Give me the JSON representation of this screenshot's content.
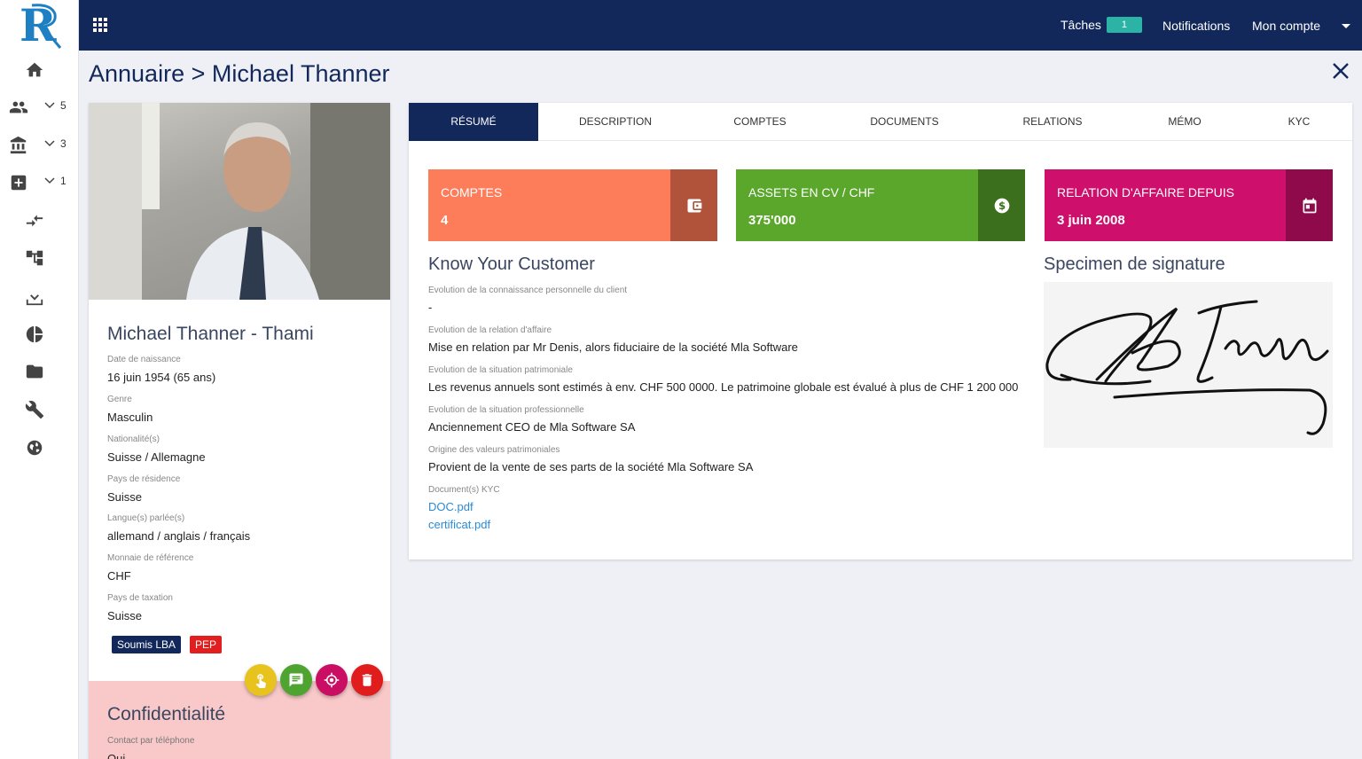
{
  "topbar": {
    "tasks_label": "Tâches",
    "tasks_count": "1",
    "notifications_label": "Notifications",
    "account_label": "Mon compte"
  },
  "sidebar": {
    "items": [
      {
        "icon": "home-icon",
        "count": ""
      },
      {
        "icon": "users-icon",
        "count": "5"
      },
      {
        "icon": "bank-icon",
        "count": "3"
      },
      {
        "icon": "add-box-icon",
        "count": "1"
      },
      {
        "icon": "transfer-icon",
        "count": ""
      },
      {
        "icon": "hierarchy-icon",
        "count": ""
      },
      {
        "icon": "download-icon",
        "count": ""
      },
      {
        "icon": "pie-chart-icon",
        "count": ""
      },
      {
        "icon": "folder-icon",
        "count": ""
      },
      {
        "icon": "wrench-icon",
        "count": ""
      },
      {
        "icon": "globe-icon",
        "count": ""
      }
    ]
  },
  "breadcrumb": {
    "root": "Annuaire",
    "separator": ">",
    "current": "Michael Thanner"
  },
  "profile": {
    "name": "Michael Thanner - Thami",
    "fields": [
      {
        "label": "Date de naissance",
        "value": "16 juin 1954 (65 ans)"
      },
      {
        "label": "Genre",
        "value": "Masculin"
      },
      {
        "label": "Nationalité(s)",
        "value": "Suisse / Allemagne"
      },
      {
        "label": "Pays de résidence",
        "value": "Suisse"
      },
      {
        "label": "Langue(s) parlée(s)",
        "value": "allemand / anglais / français"
      },
      {
        "label": "Monnaie de référence",
        "value": "CHF"
      },
      {
        "label": "Pays de taxation",
        "value": "Suisse"
      }
    ],
    "tags": {
      "lba": "Soumis LBA",
      "pep": "PEP"
    },
    "confidentiality": {
      "title": "Confidentialité",
      "label": "Contact par téléphone",
      "value": "Oui"
    }
  },
  "tabs": [
    "RÉSUMÉ",
    "DESCRIPTION",
    "COMPTES",
    "DOCUMENTS",
    "RELATIONS",
    "MÉMO",
    "KYC"
  ],
  "stats": [
    {
      "label": "COMPTES",
      "value": "4",
      "color": "#fd7d5a",
      "icon_bg": "#b1533b",
      "icon": "wallet-icon"
    },
    {
      "label": "ASSETS EN CV / CHF",
      "value": "375'000",
      "color": "#5aa72b",
      "icon_bg": "#3b6e1d",
      "icon": "dollar-icon"
    },
    {
      "label": "RELATION D'AFFAIRE DEPUIS",
      "value": "3 juin 2008",
      "color": "#cf0f6c",
      "icon_bg": "#8e0a4a",
      "icon": "calendar-icon"
    }
  ],
  "kyc": {
    "title": "Know Your Customer",
    "fields": [
      {
        "label": "Evolution de la connaissance personnelle du client",
        "value": "-"
      },
      {
        "label": "Evolution de la relation d'affaire",
        "value": "Mise en relation par Mr Denis, alors fiduciaire de la société Mla Software"
      },
      {
        "label": "Evolution de la situation patrimoniale",
        "value": "Les revenus annuels sont estimés à env. CHF 500 0000. Le patrimoine globale est évalué à plus de CHF 1 200 000"
      },
      {
        "label": "Evolution de la situation professionnelle",
        "value": "Anciennement CEO de Mla Software SA"
      },
      {
        "label": "Origine des valeurs patrimoniales",
        "value": "Provient de la vente de ses parts de la société Mla Software SA"
      }
    ],
    "docs_label": "Document(s) KYC",
    "docs": [
      "DOC.pdf",
      "certificat.pdf"
    ]
  },
  "signature": {
    "title": "Specimen de signature"
  }
}
